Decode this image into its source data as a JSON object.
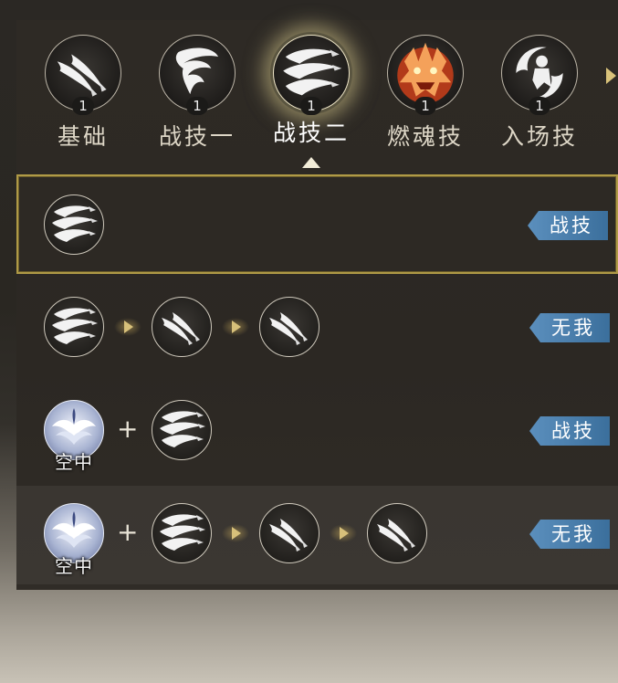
{
  "tabs": [
    {
      "label": "基础",
      "count": "1",
      "icon": "twin-blades-icon"
    },
    {
      "label": "战技一",
      "count": "1",
      "icon": "whirlwind-icon"
    },
    {
      "label": "战技二",
      "count": "1",
      "icon": "triple-claw-icon"
    },
    {
      "label": "燃魂技",
      "count": "1",
      "icon": "dragon-head-icon"
    },
    {
      "label": "入场技",
      "count": "1",
      "icon": "swirl-warrior-icon"
    }
  ],
  "active_tab": "战技二",
  "air_label": "空中",
  "plus": "+",
  "combos": [
    {
      "tag": "战技",
      "selected": true
    },
    {
      "tag": "无我"
    },
    {
      "tag": "战技"
    },
    {
      "tag": "无我"
    }
  ],
  "colors": {
    "tag_blue": "#4a7fae",
    "highlight_gold": "#b09a46",
    "arrow_gold": "#d7c07a"
  }
}
